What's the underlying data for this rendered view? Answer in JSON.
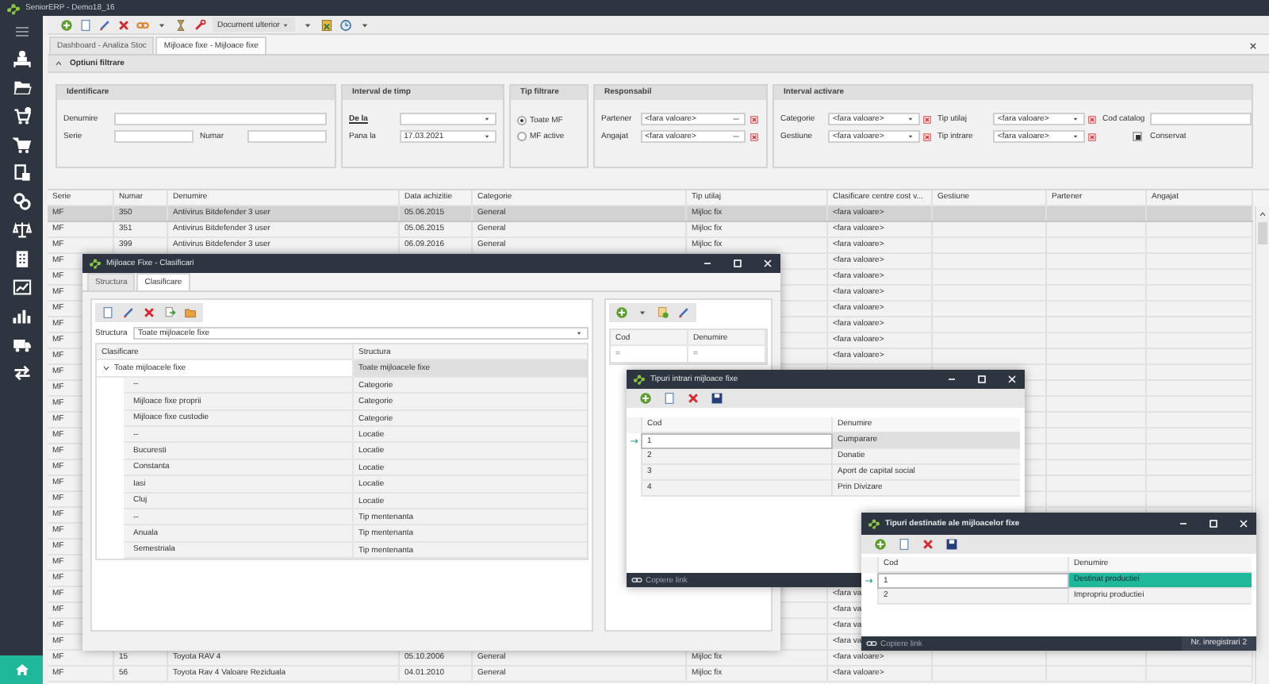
{
  "app": {
    "title": "SeniorERP - Demo18_16"
  },
  "toolbar": {
    "dropdown": "Document ulterior"
  },
  "tabs": [
    {
      "label": "Dashboard - Analiza Stoc",
      "selected": false
    },
    {
      "label": "Mijloace fixe - Mijloace fixe",
      "selected": true
    }
  ],
  "filter": {
    "title": "Optiuni filtrare",
    "expanded": true,
    "identificare": {
      "title": "Identificare",
      "denumire_label": "Denumire",
      "serie_label": "Serie",
      "numar_label": "Numar"
    },
    "interval": {
      "title": "Interval de timp",
      "from_label": "De la",
      "to_label": "Pana la",
      "to_value": "17.03.2021"
    },
    "tip_filtrare": {
      "title": "Tip filtrare",
      "options": [
        {
          "label": "Toate MF",
          "selected": true
        },
        {
          "label": "MF active",
          "selected": false
        }
      ]
    },
    "responsabil": {
      "title": "Responsabil",
      "fields": [
        {
          "label": "Partener",
          "value": "<fara valoare>"
        },
        {
          "label": "Angajat",
          "value": "<fara valoare>"
        }
      ]
    },
    "activare": {
      "title": "Interval activare",
      "combos": [
        {
          "label": "Categorie",
          "value": "<fara valoare>"
        },
        {
          "label": "Tip utilaj",
          "value": "<fara valoare>"
        },
        {
          "label": "Gestiune",
          "value": "<fara valoare>"
        },
        {
          "label": "Tip intrare",
          "value": "<fara valoare>"
        }
      ],
      "cod_catalog_label": "Cod catalog",
      "conservat": {
        "label": "Conservat",
        "checked": true
      }
    }
  },
  "table": {
    "columns": [
      "Serie",
      "Numar",
      "Denumire",
      "Data achizitie",
      "Categorie",
      "Tip utilaj",
      "Clasificare centre cost v...",
      "Gestiune",
      "Partener",
      "Angajat"
    ],
    "rows": [
      {
        "selected": true,
        "cells": [
          "MF",
          "350",
          "Antivirus Bitdefender 3 user",
          "05.06.2015",
          "General",
          "Mijloc fix",
          "<fara valoare>",
          null,
          null,
          null
        ]
      },
      {
        "selected": false,
        "cells": [
          "MF",
          "351",
          "Antivirus Bitdefender 3 user",
          "05.06.2015",
          "General",
          "Mijloc fix",
          "<fara valoare>",
          null,
          null,
          null
        ]
      },
      {
        "selected": false,
        "cells": [
          "MF",
          "399",
          "Antivirus Bitdefender 3 user",
          "06.09.2016",
          "General",
          "Mijloc fix",
          "<fara valoare>",
          null,
          null,
          null
        ]
      },
      {
        "selected": false,
        "cells": [
          "MF",
          null,
          null,
          null,
          null,
          null,
          "<fara valoare>",
          null,
          null,
          null
        ]
      },
      {
        "selected": false,
        "cells": [
          "MF",
          null,
          null,
          null,
          null,
          null,
          "<fara valoare>",
          null,
          null,
          null
        ]
      },
      {
        "selected": false,
        "cells": [
          "MF",
          null,
          null,
          null,
          null,
          null,
          "<fara valoare>",
          null,
          null,
          null
        ]
      },
      {
        "selected": false,
        "cells": [
          "MF",
          null,
          null,
          null,
          null,
          null,
          "<fara valoare>",
          null,
          null,
          null
        ]
      },
      {
        "selected": false,
        "cells": [
          "MF",
          null,
          null,
          null,
          null,
          null,
          "<fara valoare>",
          null,
          null,
          null
        ]
      },
      {
        "selected": false,
        "cells": [
          "MF",
          null,
          null,
          null,
          null,
          null,
          "<fara valoare>",
          null,
          null,
          null
        ]
      },
      {
        "selected": false,
        "cells": [
          "MF",
          null,
          null,
          null,
          null,
          null,
          "<fara valoare>",
          null,
          null,
          null
        ]
      },
      {
        "selected": false,
        "cells": [
          "MF",
          null,
          null,
          null,
          null,
          null,
          null,
          null,
          null,
          null
        ]
      },
      {
        "selected": false,
        "cells": [
          "MF",
          null,
          null,
          null,
          null,
          null,
          null,
          null,
          null,
          null
        ]
      },
      {
        "selected": false,
        "cells": [
          "MF",
          null,
          null,
          null,
          null,
          null,
          null,
          null,
          null,
          null
        ]
      },
      {
        "selected": false,
        "cells": [
          "MF",
          null,
          null,
          null,
          null,
          null,
          null,
          null,
          null,
          null
        ]
      },
      {
        "selected": false,
        "cells": [
          "MF",
          null,
          null,
          null,
          null,
          null,
          null,
          null,
          null,
          null
        ]
      },
      {
        "selected": false,
        "cells": [
          "MF",
          null,
          null,
          null,
          null,
          null,
          null,
          null,
          null,
          null
        ]
      },
      {
        "selected": false,
        "cells": [
          "MF",
          null,
          null,
          null,
          null,
          null,
          null,
          null,
          null,
          null
        ]
      },
      {
        "selected": false,
        "cells": [
          "MF",
          null,
          null,
          null,
          null,
          null,
          null,
          null,
          null,
          null
        ]
      },
      {
        "selected": false,
        "cells": [
          "MF",
          null,
          null,
          null,
          null,
          null,
          null,
          null,
          null,
          null
        ]
      },
      {
        "selected": false,
        "cells": [
          "MF",
          null,
          null,
          null,
          null,
          null,
          null,
          null,
          null,
          null
        ]
      },
      {
        "selected": false,
        "cells": [
          "MF",
          null,
          null,
          null,
          null,
          null,
          null,
          null,
          null,
          null
        ]
      },
      {
        "selected": false,
        "cells": [
          "MF",
          null,
          null,
          null,
          null,
          null,
          null,
          null,
          null,
          null
        ]
      },
      {
        "selected": false,
        "cells": [
          "MF",
          null,
          null,
          null,
          null,
          null,
          null,
          null,
          null,
          null
        ]
      },
      {
        "selected": false,
        "cells": [
          "MF",
          null,
          null,
          null,
          null,
          null,
          null,
          null,
          null,
          null
        ]
      },
      {
        "selected": false,
        "cells": [
          "MF",
          null,
          null,
          null,
          null,
          null,
          "<fara va",
          null,
          null,
          null
        ]
      },
      {
        "selected": false,
        "cells": [
          "MF",
          null,
          null,
          null,
          null,
          null,
          "<fara va",
          null,
          null,
          null
        ]
      },
      {
        "selected": false,
        "cells": [
          "MF",
          null,
          null,
          null,
          null,
          null,
          "<fara va",
          null,
          null,
          null
        ]
      },
      {
        "selected": false,
        "cells": [
          "MF",
          null,
          null,
          null,
          null,
          null,
          "<fara va",
          null,
          null,
          null
        ]
      },
      {
        "selected": false,
        "cells": [
          "MF",
          "15",
          "Toyota RAV 4",
          "05.10.2006",
          "General",
          "Mijloc fix",
          "<fara valoare>",
          null,
          null,
          null
        ]
      },
      {
        "selected": false,
        "cells": [
          "MF",
          "56",
          "Toyota Rav 4 Valoare Reziduala",
          "04.01.2010",
          "General",
          "Mijloc fix",
          "<fara valoare>",
          null,
          null,
          null
        ]
      }
    ]
  },
  "clasificari_window": {
    "title": "Mijloace Fixe - Clasificari",
    "tabs": [
      {
        "label": "Structura",
        "selected": false
      },
      {
        "label": "Clasificare",
        "selected": true
      }
    ],
    "structura_label": "Structura",
    "structura_value": "Toate mijloacele fixe",
    "columns": [
      "Clasificare",
      "Structura"
    ],
    "tree": [
      {
        "label": "Toate mijloacele fixe",
        "structura": "Toate mijloacele fixe",
        "expanded": true,
        "selected": true,
        "children": [
          {
            "label": "--",
            "structura": "Categorie",
            "selected": false
          },
          {
            "label": "Mijloace fixe proprii",
            "structura": "Categorie",
            "selected": false
          },
          {
            "label": "Mijloace fixe custodie",
            "structura": "Categorie",
            "selected": false
          },
          {
            "label": "--",
            "structura": "Locatie",
            "selected": false
          },
          {
            "label": "Bucuresti",
            "structura": "Locatie",
            "selected": false
          },
          {
            "label": "Constanta",
            "structura": "Locatie",
            "selected": false
          },
          {
            "label": "Iasi",
            "structura": "Locatie",
            "selected": false
          },
          {
            "label": "Cluj",
            "structura": "Locatie",
            "selected": false
          },
          {
            "label": "--",
            "structura": "Tip mentenanta",
            "selected": false
          },
          {
            "label": "Anuala",
            "structura": "Tip mentenanta",
            "selected": false
          },
          {
            "label": "Semestriala",
            "structura": "Tip mentenanta",
            "selected": false
          }
        ]
      }
    ],
    "side_columns": [
      "Cod",
      "Denumire"
    ],
    "side_filter_row": [
      "=",
      "="
    ]
  },
  "intrari_window": {
    "title": "Tipuri intrari mijloace fixe",
    "columns": [
      "Cod",
      "Denumire"
    ],
    "rows": [
      {
        "cod": "1",
        "denumire": "Cumparare",
        "selected": true
      },
      {
        "cod": "2",
        "denumire": "Donatie",
        "selected": false
      },
      {
        "cod": "3",
        "denumire": "Aport de capital social",
        "selected": false
      },
      {
        "cod": "4",
        "denumire": "Prin Divizare",
        "selected": false
      }
    ],
    "footer_link": "Copiere link"
  },
  "destinatie_window": {
    "title": "Tipuri destinatie ale mijloacelor fixe",
    "columns": [
      "Cod",
      "Denumire"
    ],
    "rows": [
      {
        "cod": "1",
        "denumire": "Destinat productiei",
        "selected": true
      },
      {
        "cod": "2",
        "denumire": "Impropriu productiei",
        "selected": false
      }
    ],
    "footer_link": "Copiere link",
    "record_count": "Nr. inregistrari 2"
  }
}
